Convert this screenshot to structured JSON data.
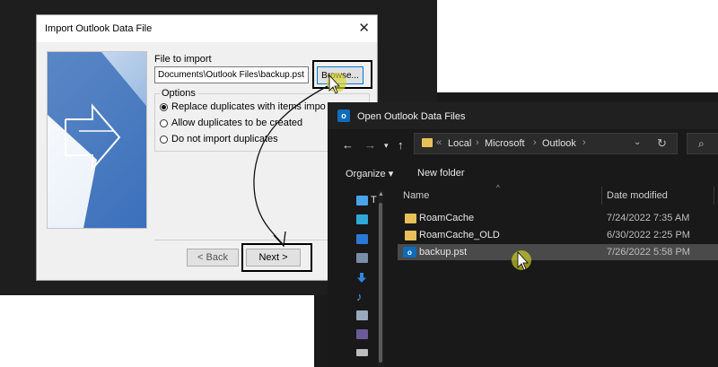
{
  "import_dialog": {
    "title": "Import Outlook Data File",
    "close_glyph": "✕",
    "file_to_import_label": "File to import",
    "file_path_value": "Documents\\Outlook Files\\backup.pst",
    "browse_label": "Browse...",
    "options_label": "Options",
    "options": [
      {
        "label": "Replace duplicates with items impo",
        "checked": true
      },
      {
        "label": "Allow duplicates to be created",
        "checked": false
      },
      {
        "label": "Do not import duplicates",
        "checked": false
      }
    ],
    "back_label": "< Back",
    "next_label": "Next >"
  },
  "explorer": {
    "title": "Open Outlook Data Files",
    "app_icon_letter": "o",
    "breadcrumbs": [
      "Local",
      "Microsoft",
      "Outlook"
    ],
    "breadcrumb_lead": "«",
    "toolbar": {
      "organize_label": "Organize ▾",
      "new_folder_label": "New folder"
    },
    "columns": {
      "name": "Name",
      "date_modified": "Date modified"
    },
    "nav_glyph": "T",
    "files": [
      {
        "name": "RoamCache",
        "date": "7/24/2022 7:35 AM",
        "kind": "folder"
      },
      {
        "name": "RoamCache_OLD",
        "date": "6/30/2022 2:25 PM",
        "kind": "folder"
      },
      {
        "name": "backup.pst",
        "date": "7/26/2022 5:58 PM",
        "kind": "pst"
      }
    ]
  },
  "colors": {
    "highlight_yellow": "#d6d628",
    "folder": "#e8c05a",
    "outlook_blue": "#0f6cbd"
  }
}
